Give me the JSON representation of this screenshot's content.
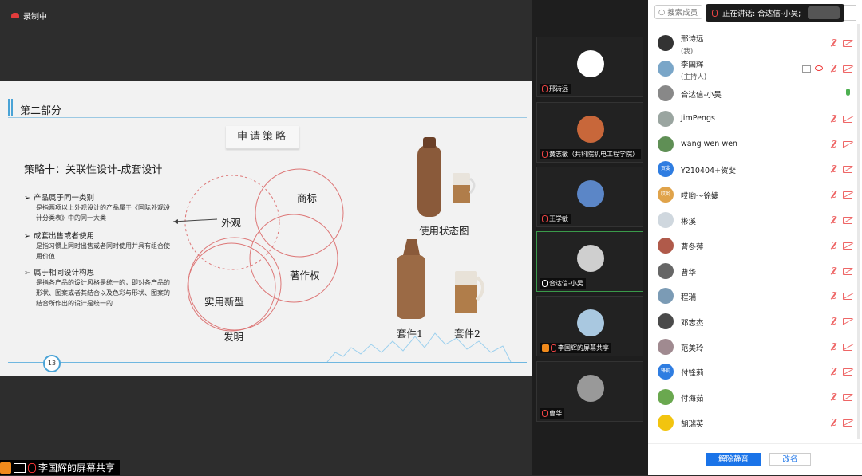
{
  "recording": {
    "label": "录制中"
  },
  "slide": {
    "section_title": "第二部分",
    "box_title": "申请策略",
    "strategy_title": "策略十：关联性设计-成套设计",
    "bullets": [
      {
        "title": "产品属于同一类别",
        "desc": "是指两项以上外观设计的产品属于《国际外观设计分类表》中的同一大类"
      },
      {
        "title": "成套出售或者使用",
        "desc": "是指习惯上同时出售或者同时使用并具有组合使用价值"
      },
      {
        "title": "属于相同设计构思",
        "desc": "是指各产品的设计风格是统一的，即对各产品的形状、图案或者其结合以及色彩与形状、图案的结合所作出的设计是统一的"
      }
    ],
    "venn_labels": {
      "waiguan": "外观",
      "shangbiao": "商标",
      "zhuzuoquan": "著作权",
      "shiyong": "实用新型",
      "faming": "发明"
    },
    "photo_labels": {
      "usage": "使用状态图",
      "set1": "套件1",
      "set2": "套件2"
    },
    "page_number": "13"
  },
  "sharer": {
    "label": "李国辉的屏幕共享"
  },
  "video_tiles": [
    {
      "name": "邢诗远",
      "avatar_color": "#ffffff"
    },
    {
      "name": "黄志敏（共科院机电工程学院）",
      "avatar_color": "#c8673a"
    },
    {
      "name": "王学敏",
      "avatar_color": "#5b86c7"
    },
    {
      "name": "合达信-小吴",
      "avatar_color": "#cfcfcf",
      "active": true
    },
    {
      "name": "李国辉的屏幕共享",
      "avatar_color": "#a9c8e0"
    },
    {
      "name": "曹华",
      "avatar_color": "#999999"
    }
  ],
  "panel": {
    "search_placeholder": "搜索成员",
    "speaking_text": "正在讲话: 合达信-小吴;",
    "participants": [
      {
        "name": "邢诗远",
        "sub": "(我)",
        "avatar_color": "#333333"
      },
      {
        "name": "李国辉",
        "sub": "(主持人)",
        "avatar_color": "#7aa6c8",
        "host": true
      },
      {
        "name": "合达信-小吴",
        "sub": "",
        "avatar_color": "#888888",
        "speaking": true
      },
      {
        "name": "JimPengs",
        "sub": "",
        "avatar_color": "#9aa5a0"
      },
      {
        "name": "wang wen wen",
        "sub": "",
        "avatar_color": "#5f8f55"
      },
      {
        "name": "Y210404+贺斐",
        "sub": "",
        "avatar_color": "#2f7de1",
        "avatar_text": "贺斐"
      },
      {
        "name": "哎哟～徐婕",
        "sub": "",
        "avatar_color": "#e0a34a",
        "avatar_text": "哎哟"
      },
      {
        "name": "彬溪",
        "sub": "",
        "avatar_color": "#cfd7de"
      },
      {
        "name": "曹冬萍",
        "sub": "",
        "avatar_color": "#b05a4a"
      },
      {
        "name": "曹华",
        "sub": "",
        "avatar_color": "#666666"
      },
      {
        "name": "程瑞",
        "sub": "",
        "avatar_color": "#7b9bb5"
      },
      {
        "name": "邓志杰",
        "sub": "",
        "avatar_color": "#4a4a4a"
      },
      {
        "name": "范美玲",
        "sub": "",
        "avatar_color": "#a08a90"
      },
      {
        "name": "付锋莉",
        "sub": "",
        "avatar_color": "#2f7de1",
        "avatar_text": "锋莉"
      },
      {
        "name": "付海茹",
        "sub": "",
        "avatar_color": "#6aa84f"
      },
      {
        "name": "胡瑞英",
        "sub": "",
        "avatar_color": "#f2c40f"
      }
    ],
    "mute_all": "解除静音",
    "rename": "改名"
  }
}
